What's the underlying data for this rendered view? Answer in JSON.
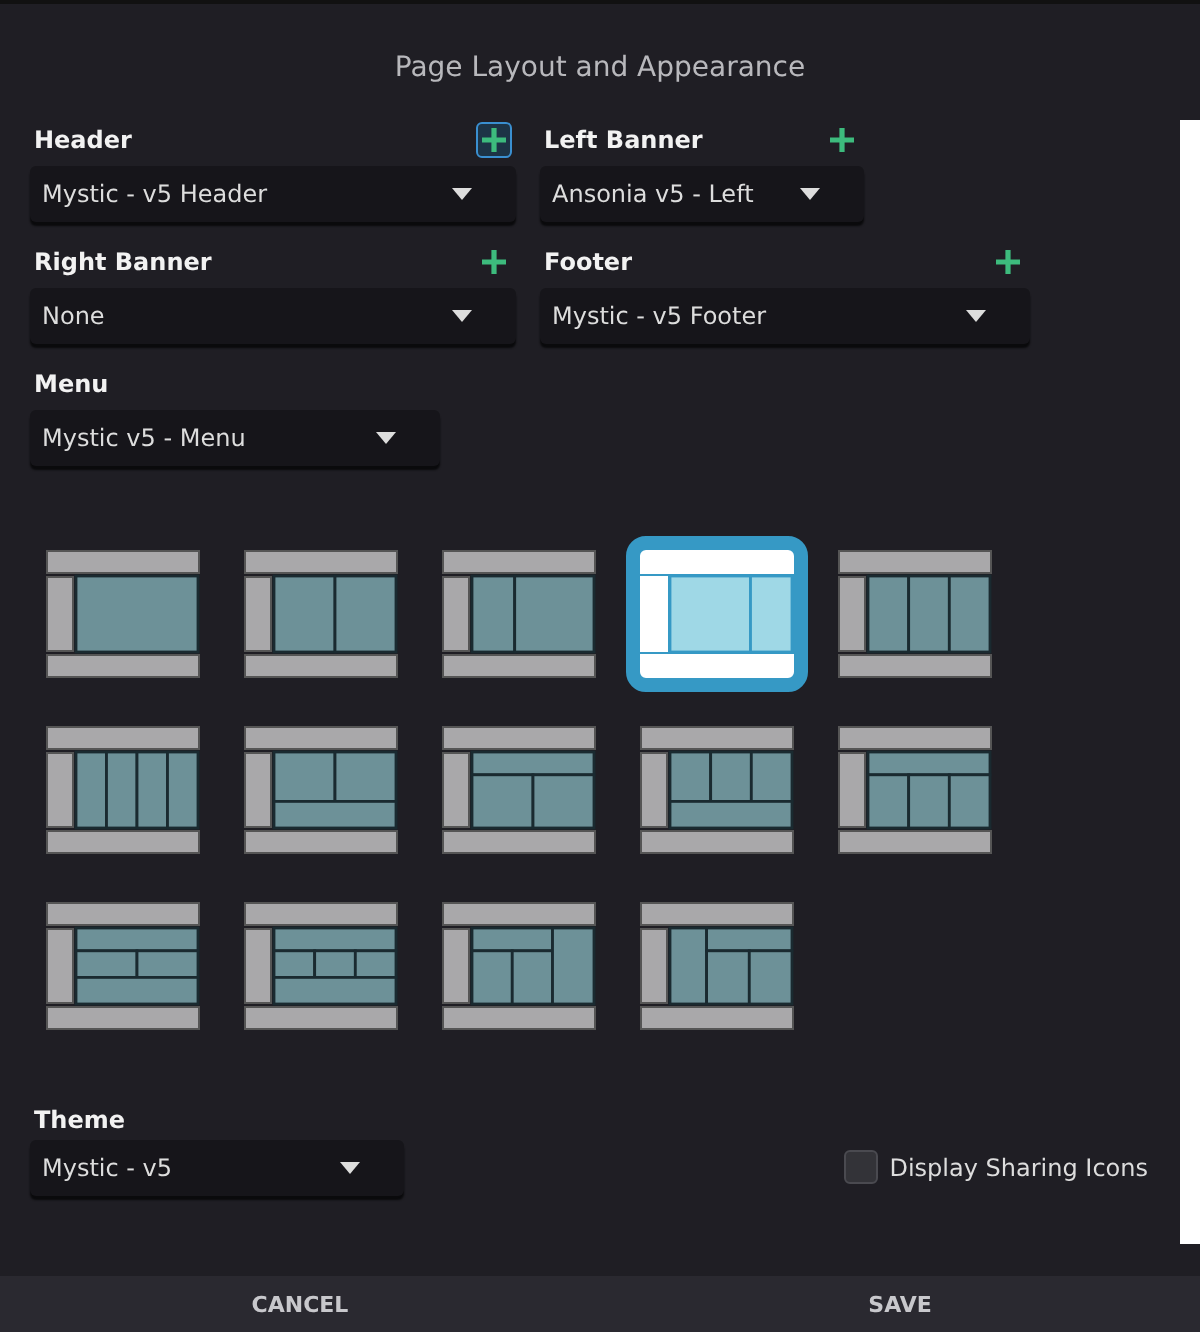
{
  "title": "Page Layout and Appearance",
  "fields": [
    {
      "label": "Header",
      "value": "Mystic - v5 Header",
      "add_button": true,
      "add_focused": true
    },
    {
      "label": "Left Banner",
      "value": "Ansonia v5 - Left",
      "add_button": true,
      "add_focused": false
    },
    {
      "label": "Right Banner",
      "value": "None",
      "add_button": true,
      "add_focused": false
    },
    {
      "label": "Footer",
      "value": "Mystic - v5 Footer",
      "add_button": true,
      "add_focused": false
    },
    {
      "label": "Menu",
      "value": "Mystic v5 - Menu",
      "add_button": false
    }
  ],
  "layouts": [
    {
      "kind": "single",
      "selected": false
    },
    {
      "kind": "two-column",
      "selected": false
    },
    {
      "kind": "narrow-wide",
      "selected": false
    },
    {
      "kind": "wide-narrow",
      "selected": true
    },
    {
      "kind": "three-column",
      "selected": false
    },
    {
      "kind": "four-column",
      "selected": false
    },
    {
      "kind": "two-over-one",
      "selected": false
    },
    {
      "kind": "one-over-two",
      "selected": false
    },
    {
      "kind": "three-over-one",
      "selected": false
    },
    {
      "kind": "one-over-three",
      "selected": false
    },
    {
      "kind": "one-two-one",
      "selected": false
    },
    {
      "kind": "one-three-one",
      "selected": false
    },
    {
      "kind": "grid-right-column",
      "selected": false
    },
    {
      "kind": "left-column-grid",
      "selected": false
    }
  ],
  "theme": {
    "label": "Theme",
    "value": "Mystic - v5"
  },
  "sharing": {
    "label": "Display Sharing Icons",
    "checked": false
  },
  "buttons": [
    "CANCEL",
    "SAVE"
  ]
}
